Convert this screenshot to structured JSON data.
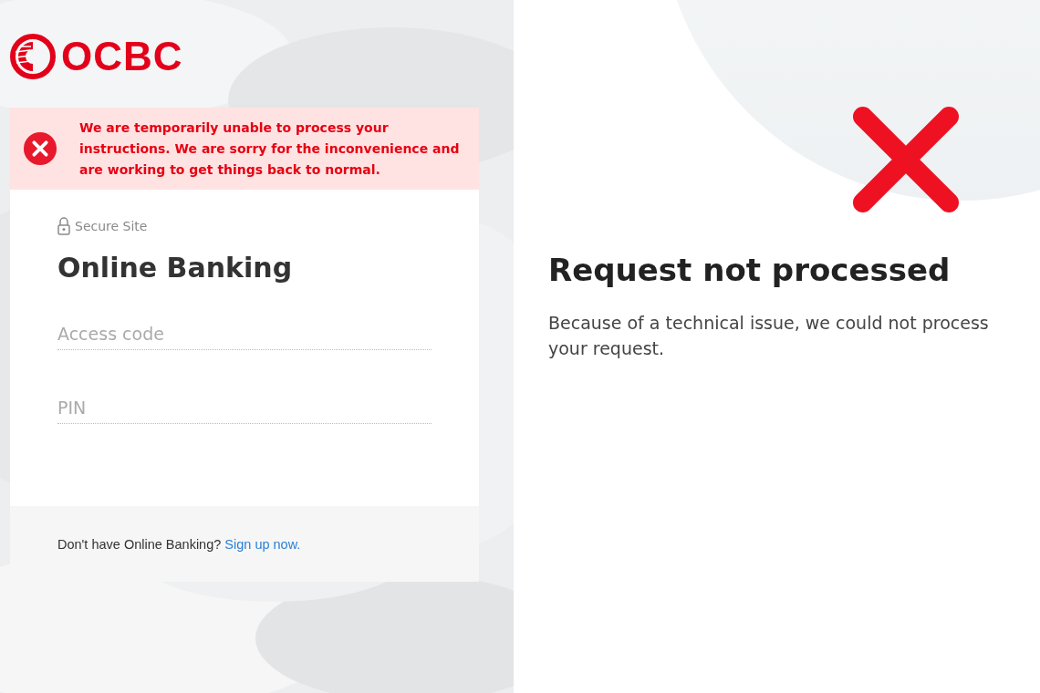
{
  "login_page": {
    "logo": {
      "text": "OCBC"
    },
    "alert": {
      "message": "We are temporarily unable to process your instructions. We are sorry for the inconvenience and are working to get things back to normal."
    },
    "secure_label": "Secure Site",
    "title": "Online Banking",
    "fields": [
      {
        "placeholder": "Access code"
      },
      {
        "placeholder": "PIN"
      }
    ],
    "footer": {
      "text": "Don't have Online Banking?",
      "link": "Sign up now."
    }
  },
  "error_page": {
    "title": "Request not processed",
    "message": "Because of a technical issue, we could not process your request."
  }
}
